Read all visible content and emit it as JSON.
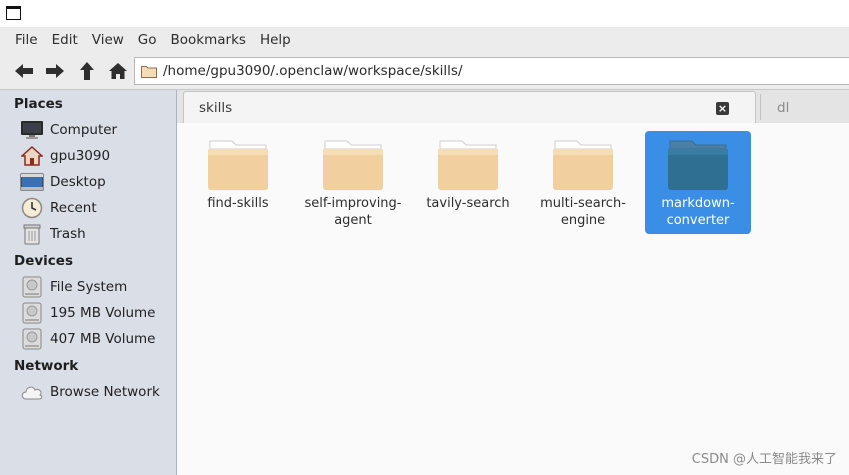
{
  "menu": [
    "File",
    "Edit",
    "View",
    "Go",
    "Bookmarks",
    "Help"
  ],
  "toolbar": {
    "back_icon": "arrow-left-icon",
    "forward_icon": "arrow-right-icon",
    "up_icon": "arrow-up-icon",
    "home_icon": "home-icon"
  },
  "location": {
    "path": "/home/gpu3090/.openclaw/workspace/skills/"
  },
  "sidebar": {
    "places_title": "Places",
    "places": [
      {
        "label": "Computer",
        "icon": "monitor-icon"
      },
      {
        "label": "gpu3090",
        "icon": "home-folder-icon"
      },
      {
        "label": "Desktop",
        "icon": "desktop-icon"
      },
      {
        "label": "Recent",
        "icon": "clock-icon"
      },
      {
        "label": "Trash",
        "icon": "trash-icon"
      }
    ],
    "devices_title": "Devices",
    "devices": [
      {
        "label": "File System",
        "icon": "drive-icon"
      },
      {
        "label": "195 MB Volume",
        "icon": "drive-icon"
      },
      {
        "label": "407 MB Volume",
        "icon": "drive-icon"
      }
    ],
    "network_title": "Network",
    "network": [
      {
        "label": "Browse Network",
        "icon": "cloud-icon"
      }
    ]
  },
  "tabs": {
    "active": "skills",
    "inactive": "dl"
  },
  "files": [
    {
      "line1": "find-skills",
      "line2": "",
      "selected": false
    },
    {
      "line1": "self-improving-",
      "line2": "agent",
      "selected": false
    },
    {
      "line1": "tavily-search",
      "line2": "",
      "selected": false
    },
    {
      "line1": "multi-search-",
      "line2": "engine",
      "selected": false
    },
    {
      "line1": "markdown-",
      "line2": "converter",
      "selected": true
    }
  ],
  "watermark": "CSDN @人工智能我来了",
  "colors": {
    "selection": "#3b8ee5",
    "folder": "#f1cf9e",
    "folder_selected": "#2f6f92",
    "sidebar_bg": "#d9dee7"
  }
}
